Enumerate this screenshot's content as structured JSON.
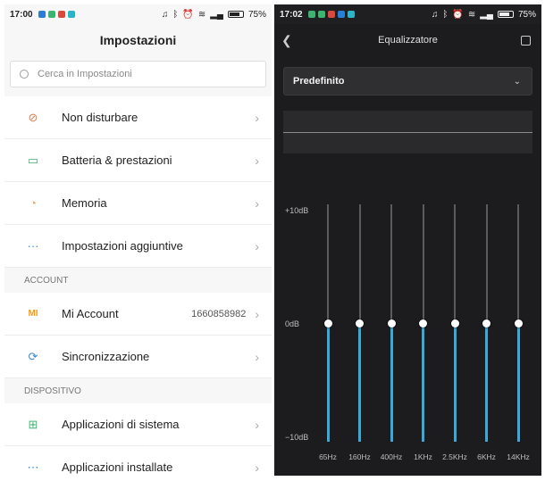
{
  "left": {
    "status": {
      "time": "17:00",
      "battery": "75%"
    },
    "title": "Impostazioni",
    "search_placeholder": "Cerca in Impostazioni",
    "group1": [
      {
        "icon": "dnd-icon",
        "glyph": "⊘",
        "color": "#e07a4a",
        "label": "Non disturbare"
      },
      {
        "icon": "battery-icon",
        "glyph": "▭",
        "color": "#3cb371",
        "label": "Batteria & prestazioni"
      },
      {
        "icon": "storage-icon",
        "glyph": "◔",
        "color": "#e8a868",
        "label": "Memoria"
      },
      {
        "icon": "more-icon",
        "glyph": "···",
        "color": "#3a8ad8",
        "label": "Impostazioni aggiuntive"
      }
    ],
    "account_header": "ACCOUNT",
    "group2": [
      {
        "icon": "mi-icon",
        "glyph": "MI",
        "color": "#f39c12",
        "label": "Mi Account",
        "value": "1660858982"
      },
      {
        "icon": "sync-icon",
        "glyph": "⟳",
        "color": "#3a8ad8",
        "label": "Sincronizzazione",
        "value": ""
      }
    ],
    "device_header": "DISPOSITIVO",
    "group3": [
      {
        "icon": "apps-icon",
        "glyph": "⊞",
        "color": "#3cb371",
        "label": "Applicazioni di sistema"
      },
      {
        "icon": "installed-apps-icon",
        "glyph": "⋯",
        "color": "#3a8ad8",
        "label": "Applicazioni installate"
      }
    ]
  },
  "right": {
    "status": {
      "time": "17:02",
      "battery": "75%"
    },
    "title": "Equalizzatore",
    "preset": "Predefinito",
    "db_labels": {
      "top": "+10dB",
      "mid": "0dB",
      "bottom": "−10dB"
    },
    "bands": [
      {
        "label": "65Hz",
        "gain_db": 0
      },
      {
        "label": "160Hz",
        "gain_db": 0
      },
      {
        "label": "400Hz",
        "gain_db": 0
      },
      {
        "label": "1KHz",
        "gain_db": 0
      },
      {
        "label": "2.5KHz",
        "gain_db": 0
      },
      {
        "label": "6KHz",
        "gain_db": 0
      },
      {
        "label": "14KHz",
        "gain_db": 0
      }
    ],
    "accent": "#38a9d8"
  }
}
